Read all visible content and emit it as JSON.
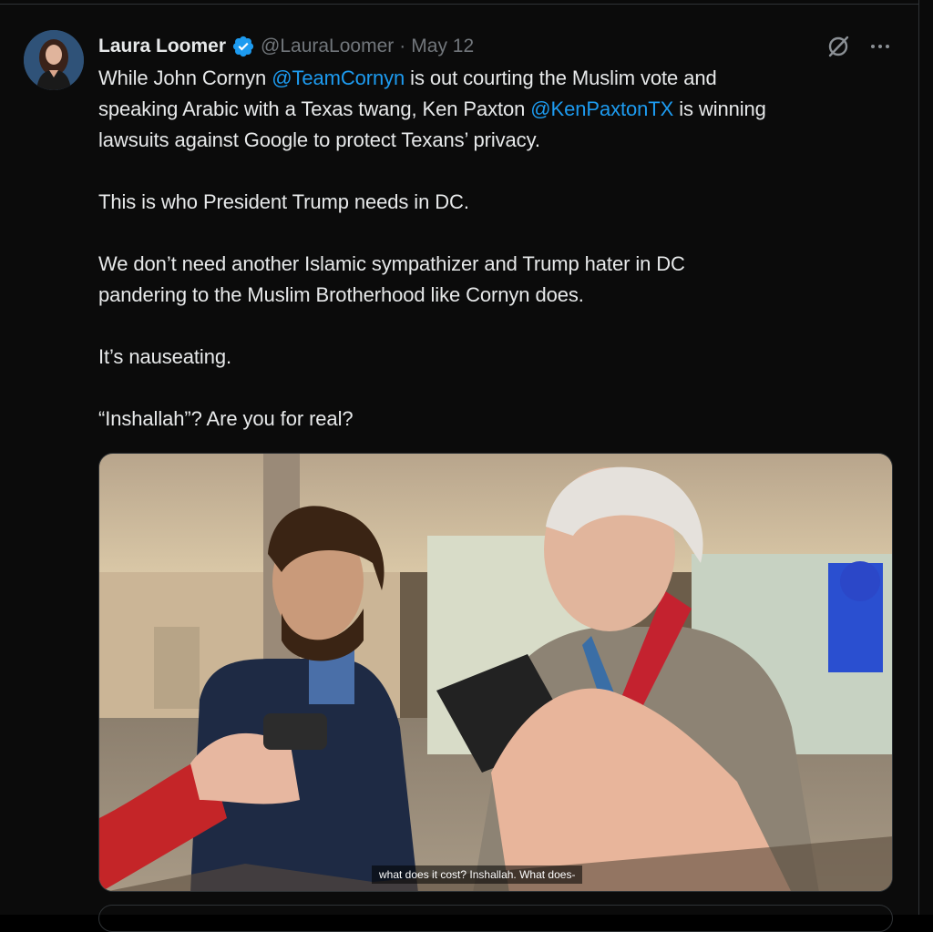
{
  "tweet": {
    "author_name": "Laura Loomer",
    "handle": "@LauraLoomer",
    "separator": "·",
    "date": "May 12",
    "verified": true,
    "icons": {
      "verified": "verified-badge-icon",
      "grok": "grok-icon",
      "more": "more-options-icon"
    },
    "text": {
      "p1_l1_a": "While John Cornyn ",
      "p1_l1_mention": "@TeamCornyn",
      "p1_l1_b": " is out courting the Muslim vote and",
      "p1_l2_a": "speaking Arabic with a Texas twang, Ken Paxton ",
      "p1_l2_mention": "@KenPaxtonTX",
      "p1_l2_b": " is winning",
      "p1_l3": "lawsuits against Google to protect Texans’ privacy.",
      "p2": "This is who President Trump needs in DC.",
      "p3_l1": "We don’t need another Islamic sympathizer and Trump hater in DC",
      "p3_l2": "pandering to the Muslim Brotherhood like Cornyn does.",
      "p4": "It’s nauseating.",
      "p5": "“Inshallah”? Are you for real?"
    },
    "media": {
      "type": "video",
      "caption": "what does it cost? Inshallah. What does-"
    }
  },
  "colors": {
    "background": "#0b0b0b",
    "text": "#e7e9ea",
    "secondary": "#71767b",
    "link": "#1d9bf0",
    "verified": "#1d9bf0",
    "border": "#2f3336"
  }
}
